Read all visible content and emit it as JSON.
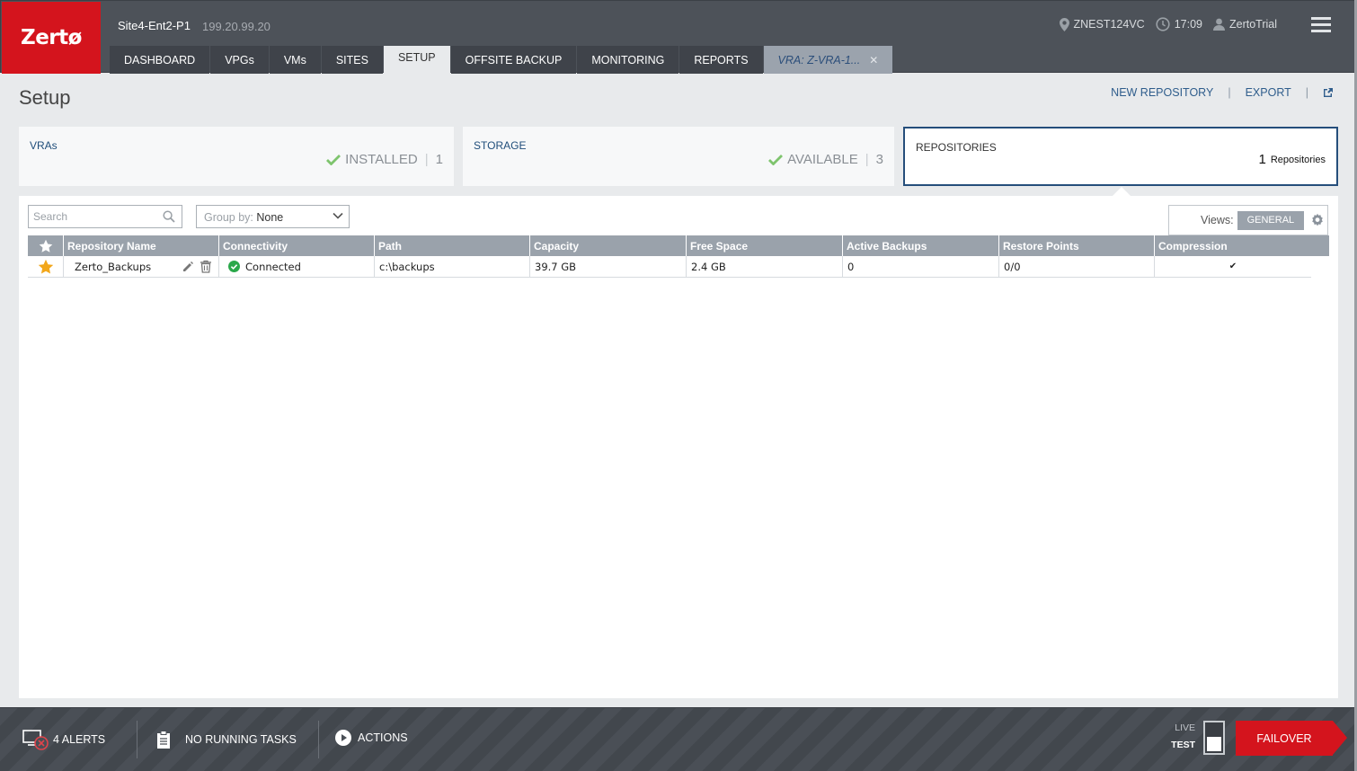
{
  "header": {
    "logo": "Zertø",
    "site_name": "Site4-Ent2-P1",
    "site_ip": "199.20.99.20",
    "vcenter": "ZNEST124VC",
    "time": "17:09",
    "user": "ZertoTrial"
  },
  "tabs": [
    {
      "label": "DASHBOARD"
    },
    {
      "label": "VPGs"
    },
    {
      "label": "VMs"
    },
    {
      "label": "SITES"
    },
    {
      "label": "SETUP"
    },
    {
      "label": "OFFSITE BACKUP"
    },
    {
      "label": "MONITORING"
    },
    {
      "label": "REPORTS"
    },
    {
      "label": "VRA: Z-VRA-1..."
    }
  ],
  "page": {
    "title": "Setup",
    "new_repository": "NEW REPOSITORY",
    "export": "EXPORT",
    "separator": "|"
  },
  "cards": {
    "vras": {
      "title": "VRAs",
      "status": "INSTALLED",
      "count": "1"
    },
    "storage": {
      "title": "STORAGE",
      "status": "AVAILABLE",
      "count": "3"
    },
    "repositories": {
      "title": "REPOSITORIES",
      "count": "1",
      "unit": "Repositories"
    }
  },
  "toolbar": {
    "search_placeholder": "Search",
    "group_by_label": "Group by:",
    "group_by_value": "None",
    "views_label": "Views:",
    "views_value": "GENERAL"
  },
  "table": {
    "headers": [
      "Repository Name",
      "Connectivity",
      "Path",
      "Capacity",
      "Free Space",
      "Active Backups",
      "Restore Points",
      "Compression"
    ],
    "rows": [
      {
        "name": "Zerto_Backups",
        "connectivity": "Connected",
        "path": "c:\\backups",
        "capacity": "39.7 GB",
        "free_space": "2.4 GB",
        "active_backups": "0",
        "restore_points": "0/0",
        "compression": "✔"
      }
    ]
  },
  "footer": {
    "alerts": "4 ALERTS",
    "tasks": "NO RUNNING TASKS",
    "actions": "ACTIONS",
    "live": "LIVE",
    "test": "TEST",
    "failover": "FAILOVER"
  },
  "colors": {
    "brand_red": "#d4141d",
    "header_bg": "#4d5259",
    "link_blue": "#2f5d8c",
    "success_green": "#2aa84a",
    "star_gold": "#f2a71b"
  }
}
